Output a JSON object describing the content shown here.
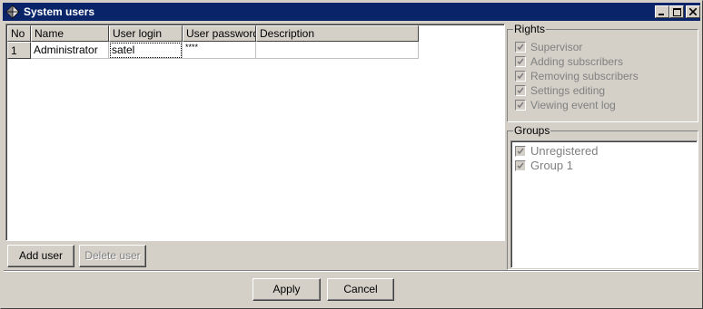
{
  "window": {
    "title": "System users",
    "minimize": "minimize",
    "maximize": "maximize",
    "close": "close"
  },
  "grid": {
    "columns": [
      "No",
      "Name",
      "User login",
      "User password",
      "Description"
    ],
    "rows": [
      {
        "no": "1",
        "name": "Administrator",
        "login": "satel",
        "password": "****",
        "description": ""
      }
    ]
  },
  "buttons": {
    "add_user": "Add user",
    "delete_user": "Delete user",
    "apply": "Apply",
    "cancel": "Cancel"
  },
  "rights": {
    "legend": "Rights",
    "items": [
      "Supervisor",
      "Adding subscribers",
      "Removing subscribers",
      "Settings editing",
      "Viewing event log"
    ]
  },
  "groups": {
    "legend": "Groups",
    "items": [
      "Unregistered",
      "Group 1"
    ]
  }
}
